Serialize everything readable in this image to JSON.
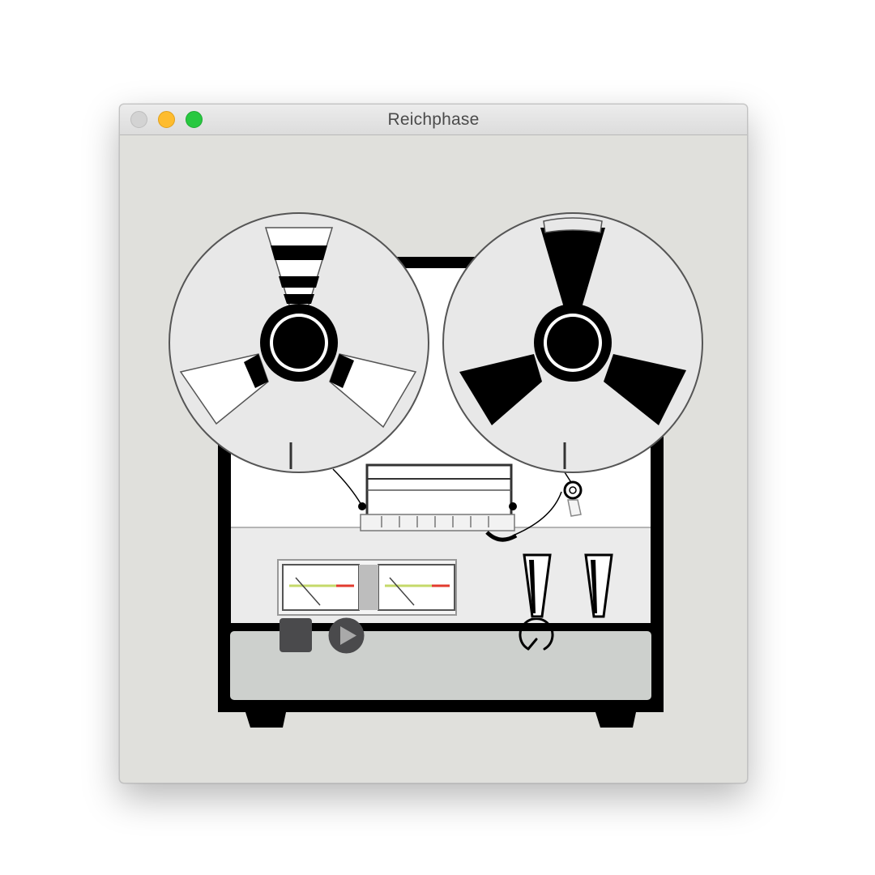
{
  "window": {
    "title": "Reichphase",
    "traffic_lights": [
      "close",
      "minimize",
      "zoom"
    ]
  },
  "controls": {
    "stop_icon": "stop-icon",
    "play_icon": "play-icon",
    "knob_icon": "knob-dial-icon"
  },
  "colors": {
    "background": "#e0e0dc",
    "control_panel": "#cdd0cd",
    "control_glyph": "#4a4a4c"
  }
}
